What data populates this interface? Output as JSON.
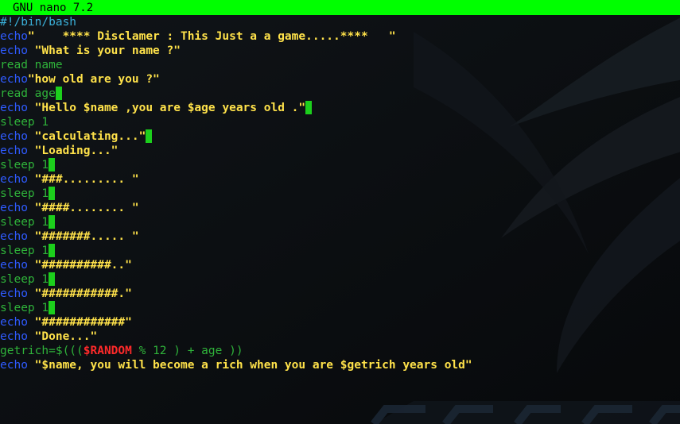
{
  "window": {
    "title": "GNU nano 7.2"
  },
  "colors": {
    "titlebar_bg": "#00ff00",
    "echo": "#2f5bff",
    "read_sleep": "#2fb33a",
    "string": "#ffe24a",
    "random": "#ff2a2a",
    "shebang": "#3ab0d9"
  },
  "lines": [
    {
      "parts": [
        {
          "cls": "shebang",
          "text": "#!/bin/bash"
        }
      ]
    },
    {
      "parts": [
        {
          "cls": "kw-echo",
          "text": "echo"
        },
        {
          "cls": "str",
          "text": "\"    **** Disclamer : This Just a a game.....****   \""
        }
      ]
    },
    {
      "parts": [
        {
          "cls": "kw-echo",
          "text": "echo"
        },
        {
          "cls": "str",
          "text": " \"What is your name ?\""
        }
      ]
    },
    {
      "parts": [
        {
          "cls": "kw-read",
          "text": "read name"
        }
      ]
    },
    {
      "parts": [
        {
          "cls": "kw-echo",
          "text": "echo"
        },
        {
          "cls": "str",
          "text": "\"how old are you ?\""
        }
      ]
    },
    {
      "parts": [
        {
          "cls": "kw-read",
          "text": "read age"
        }
      ],
      "cursor": true
    },
    {
      "parts": [
        {
          "cls": "kw-echo",
          "text": "echo"
        },
        {
          "cls": "str",
          "text": " \"Hello $name ,you are $age years old .\""
        }
      ],
      "cursor": true
    },
    {
      "parts": [
        {
          "cls": "kw-sleep",
          "text": "sleep 1"
        }
      ]
    },
    {
      "parts": [
        {
          "cls": "kw-echo",
          "text": "echo"
        },
        {
          "cls": "str",
          "text": " \"calculating...\""
        }
      ],
      "cursor": true
    },
    {
      "parts": [
        {
          "cls": "kw-echo",
          "text": "echo"
        },
        {
          "cls": "str",
          "text": " \"Loading...\""
        }
      ]
    },
    {
      "parts": [
        {
          "cls": "kw-sleep",
          "text": "sleep 1"
        }
      ],
      "cursor": true
    },
    {
      "parts": [
        {
          "cls": "kw-echo",
          "text": "echo"
        },
        {
          "cls": "str",
          "text": " \"###......... \""
        }
      ]
    },
    {
      "parts": [
        {
          "cls": "kw-sleep",
          "text": "sleep 1"
        }
      ],
      "cursor": true
    },
    {
      "parts": [
        {
          "cls": "kw-echo",
          "text": "echo"
        },
        {
          "cls": "str",
          "text": " \"####........ \""
        }
      ]
    },
    {
      "parts": [
        {
          "cls": "kw-sleep",
          "text": "sleep 1"
        }
      ],
      "cursor": true
    },
    {
      "parts": [
        {
          "cls": "kw-echo",
          "text": "echo"
        },
        {
          "cls": "str",
          "text": " \"#######..... \""
        }
      ]
    },
    {
      "parts": [
        {
          "cls": "kw-sleep",
          "text": "sleep 1"
        }
      ],
      "cursor": true
    },
    {
      "parts": [
        {
          "cls": "kw-echo",
          "text": "echo"
        },
        {
          "cls": "str",
          "text": " \"##########..\""
        }
      ]
    },
    {
      "parts": [
        {
          "cls": "kw-sleep",
          "text": "sleep 1"
        }
      ],
      "cursor": true
    },
    {
      "parts": [
        {
          "cls": "kw-echo",
          "text": "echo"
        },
        {
          "cls": "str",
          "text": " \"###########.\""
        }
      ]
    },
    {
      "parts": [
        {
          "cls": "kw-sleep",
          "text": "sleep 1"
        }
      ],
      "cursor": true
    },
    {
      "parts": [
        {
          "cls": "kw-echo",
          "text": "echo"
        },
        {
          "cls": "str",
          "text": " \"############\""
        }
      ]
    },
    {
      "parts": [
        {
          "cls": "kw-echo",
          "text": "echo"
        },
        {
          "cls": "str",
          "text": " \"Done...\""
        }
      ]
    },
    {
      "parts": [
        {
          "cls": "plain",
          "text": "getrich=$((("
        },
        {
          "cls": "var-random",
          "text": "$RANDOM"
        },
        {
          "cls": "plain",
          "text": " % 12 ) + age ))"
        }
      ]
    },
    {
      "parts": [
        {
          "cls": "kw-echo",
          "text": "echo"
        },
        {
          "cls": "str",
          "text": " \"$name, you will become a rich when you are $getrich years old\""
        }
      ]
    }
  ]
}
